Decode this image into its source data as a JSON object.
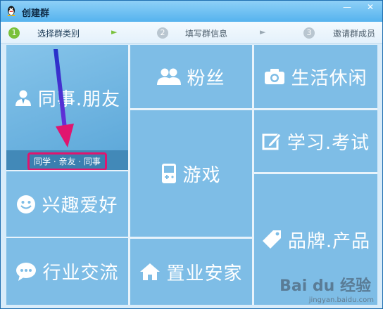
{
  "window": {
    "title": "创建群",
    "minimize_symbol": "—",
    "close_symbol": "✕"
  },
  "steps": [
    {
      "num": "1",
      "label": "选择群类别",
      "active": true
    },
    {
      "num": "2",
      "label": "填写群信息",
      "active": false
    },
    {
      "num": "3",
      "label": "邀请群成员",
      "active": false
    }
  ],
  "step_arrow": "►",
  "categories": {
    "colleagues_friends": {
      "label": "同事.朋友",
      "sub": "同学 · 亲友 · 同事",
      "icon": "person-icon"
    },
    "fans": {
      "label": "粉丝",
      "icon": "people-icon"
    },
    "leisure": {
      "label": "生活休闲",
      "icon": "camera-icon"
    },
    "study": {
      "label": "学习.考试",
      "icon": "edit-icon"
    },
    "games": {
      "label": "游戏",
      "icon": "gamepad-icon"
    },
    "hobbies": {
      "label": "兴趣爱好",
      "icon": "smile-icon"
    },
    "brands": {
      "label": "品牌.产品",
      "icon": "tag-icon"
    },
    "industry": {
      "label": "行业交流",
      "icon": "chat-icon"
    },
    "property": {
      "label": "置业安家",
      "icon": "house-icon"
    }
  },
  "watermark": {
    "brand": "Bai du 经验",
    "url": "jingyan.baidu.com"
  },
  "colors": {
    "tile": "#7ebde6",
    "selected_sub": "#4289b8",
    "highlight": "#e0156f",
    "step_active": "#7ac13b"
  }
}
